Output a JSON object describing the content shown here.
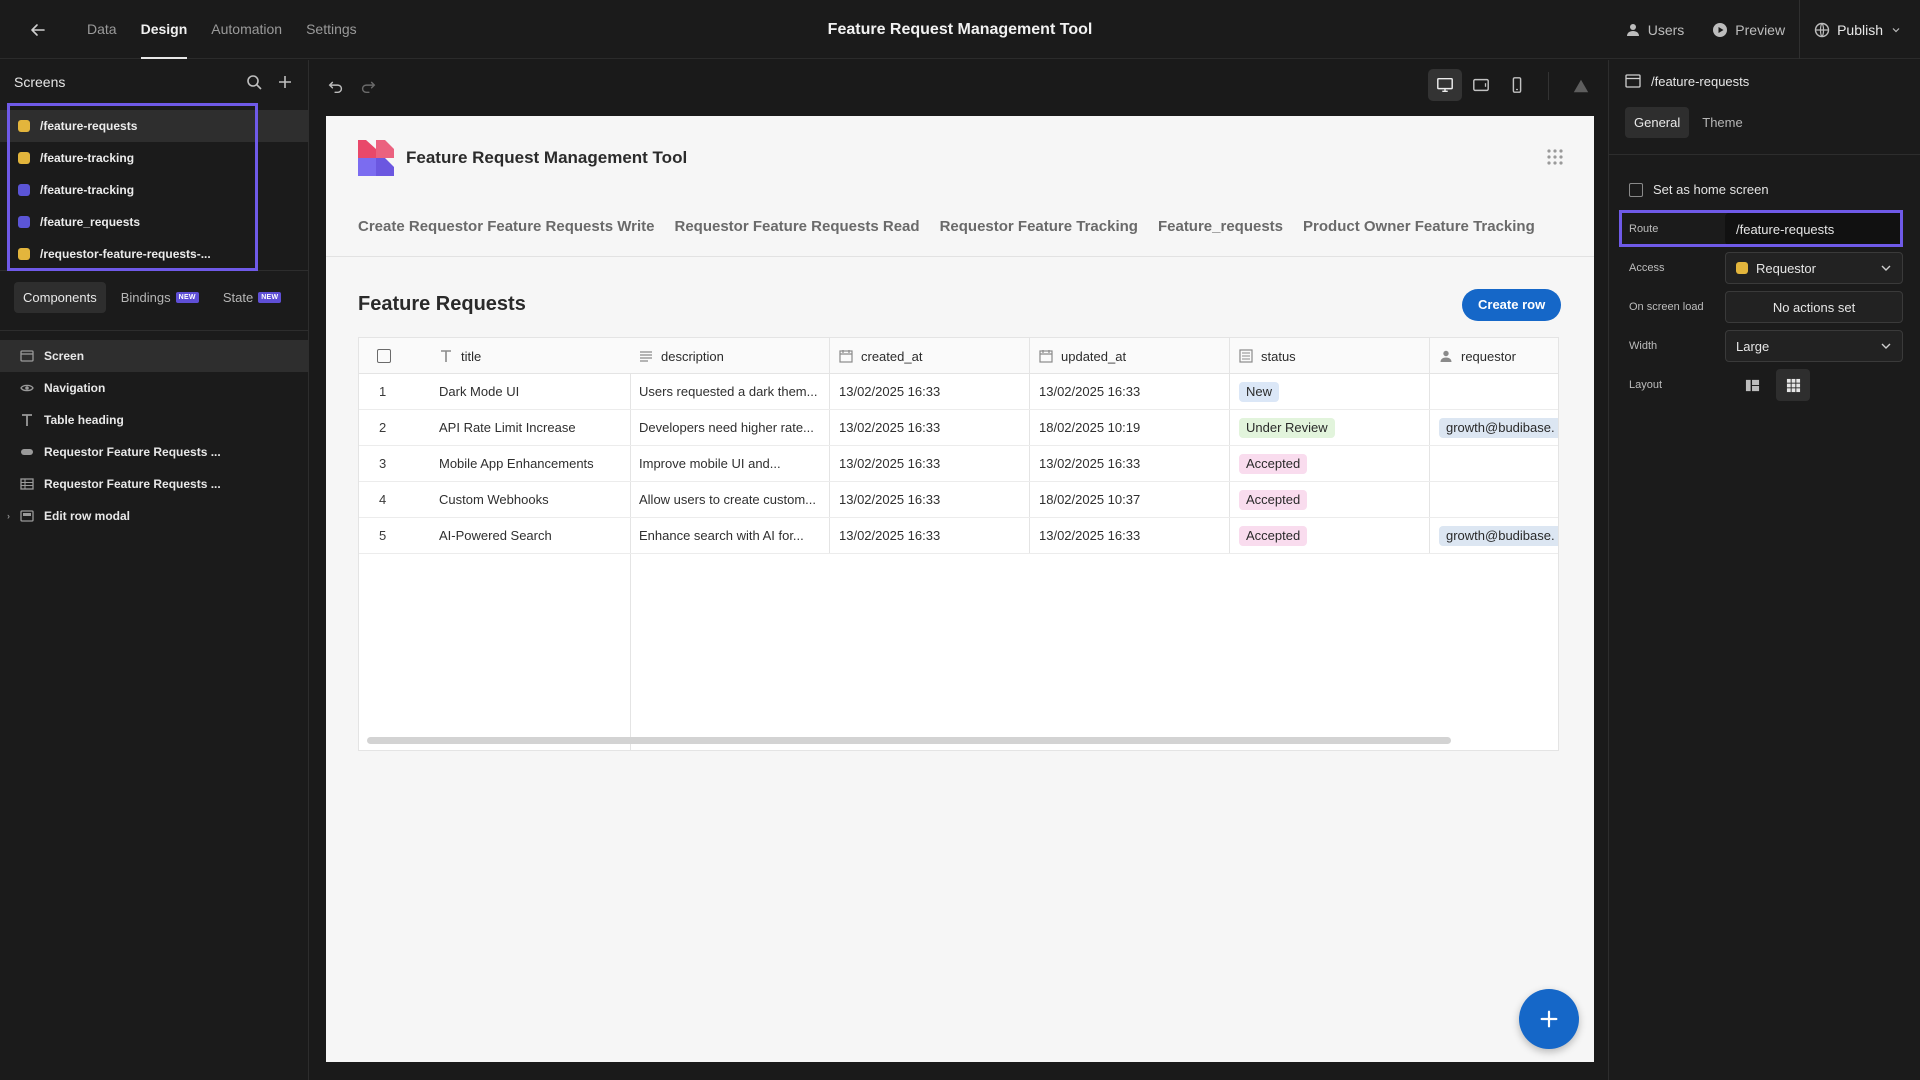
{
  "topbar": {
    "tabs": [
      "Data",
      "Design",
      "Automation",
      "Settings"
    ],
    "active_tab": "Design",
    "title": "Feature Request Management Tool",
    "users_label": "Users",
    "preview_label": "Preview",
    "publish_label": "Publish"
  },
  "screens": {
    "title": "Screens",
    "items": [
      {
        "route": "/feature-requests",
        "color": "#e3b53c",
        "selected": true
      },
      {
        "route": "/feature-tracking",
        "color": "#e3b53c",
        "selected": false
      },
      {
        "route": "/feature-tracking",
        "color": "#5b55d6",
        "selected": false
      },
      {
        "route": "/feature_requests",
        "color": "#5b55d6",
        "selected": false
      },
      {
        "route": "/requestor-feature-requests-...",
        "color": "#e3b53c",
        "selected": false
      }
    ]
  },
  "component_tabs": {
    "components": "Components",
    "bindings": "Bindings",
    "state": "State",
    "new_badge": "NEW"
  },
  "tree": {
    "items": [
      {
        "label": "Screen",
        "icon": "screen-icon"
      },
      {
        "label": "Navigation",
        "icon": "eye-icon"
      },
      {
        "label": "Table heading",
        "icon": "text-icon"
      },
      {
        "label": "Requestor Feature Requests ...",
        "icon": "button-group-icon"
      },
      {
        "label": "Requestor Feature Requests ...",
        "icon": "table-icon"
      },
      {
        "label": "Edit row modal",
        "icon": "modal-icon"
      }
    ]
  },
  "preview": {
    "app_title": "Feature Request Management Tool",
    "nav": [
      "Create Requestor Feature Requests Write",
      "Requestor Feature Requests Read",
      "Requestor Feature Tracking",
      "Feature_requests",
      "Product Owner Feature Tracking"
    ],
    "section_title": "Feature Requests",
    "create_row": "Create row",
    "fab_label": "+",
    "columns": [
      "title",
      "description",
      "created_at",
      "updated_at",
      "status",
      "requestor"
    ],
    "rows": [
      {
        "n": "1",
        "title": "Dark Mode UI",
        "description": "Users requested a dark them...",
        "created_at": "13/02/2025 16:33",
        "updated_at": "13/02/2025 16:33",
        "status": "New",
        "requestor": ""
      },
      {
        "n": "2",
        "title": "API Rate Limit Increase",
        "description": "Developers need higher rate...",
        "created_at": "13/02/2025 16:33",
        "updated_at": "18/02/2025 10:19",
        "status": "Under Review",
        "requestor": "growth@budibase."
      },
      {
        "n": "3",
        "title": "Mobile App Enhancements",
        "description": "Improve mobile UI and...",
        "created_at": "13/02/2025 16:33",
        "updated_at": "13/02/2025 16:33",
        "status": "Accepted",
        "requestor": ""
      },
      {
        "n": "4",
        "title": "Custom Webhooks",
        "description": "Allow users to create custom...",
        "created_at": "13/02/2025 16:33",
        "updated_at": "18/02/2025 10:37",
        "status": "Accepted",
        "requestor": ""
      },
      {
        "n": "5",
        "title": "AI-Powered Search",
        "description": "Enhance search with AI for...",
        "created_at": "13/02/2025 16:33",
        "updated_at": "13/02/2025 16:33",
        "status": "Accepted",
        "requestor": "growth@budibase."
      }
    ]
  },
  "right_panel": {
    "screen_route": "/feature-requests",
    "tabs": [
      "General",
      "Theme"
    ],
    "home_label": "Set as home screen",
    "route_label": "Route",
    "route_value": "/feature-requests",
    "access_label": "Access",
    "access_value": "Requestor",
    "access_color": "#e3b53c",
    "onload_label": "On screen load",
    "onload_value": "No actions set",
    "width_label": "Width",
    "width_value": "Large",
    "layout_label": "Layout"
  },
  "colors": {
    "accent": "#1567c8",
    "highlight": "#6f5ae8"
  }
}
